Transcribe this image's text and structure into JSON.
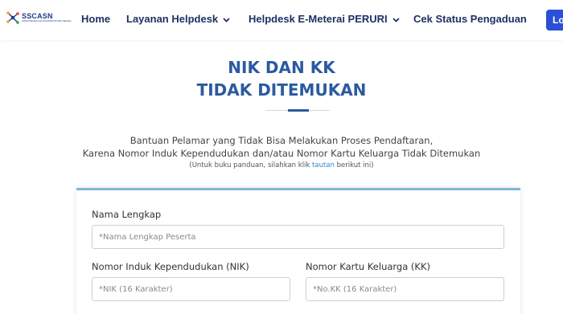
{
  "nav": {
    "logo_text": "SSCASN",
    "logo_subtext": "SISTEM SELEKSI CALON APARATUR SIPIL NEGARA",
    "home": "Home",
    "layanan_helpdesk": "Layanan Helpdesk",
    "helpdesk_emeterai": "Helpdesk E-Meterai PERURI",
    "cek_status": "Cek Status Pengaduan",
    "login": "Login"
  },
  "heading": {
    "line1": "NIK DAN KK",
    "line2": "TIDAK DITEMUKAN"
  },
  "description": {
    "line1": "Bantuan Pelamar yang Tidak Bisa Melakukan Proses Pendaftaran,",
    "line2": "Karena Nomor Induk Kependudukan dan/atau Nomor Kartu Keluarga Tidak Ditemukan",
    "note_before": "(Untuk buku panduan, silahkan klik ",
    "note_link": "tautan",
    "note_after": " berikut ini)"
  },
  "form": {
    "nama_label": "Nama Lengkap",
    "nama_placeholder": "*Nama Lengkap Peserta",
    "nik_label": "Nomor Induk Kependudukan (NIK)",
    "nik_placeholder": "*NIK (16 Karakter)",
    "kk_label": "Nomor Kartu Keluarga (KK)",
    "kk_placeholder": "*No.KK (16 Karakter)"
  },
  "colors": {
    "nav_text": "#1e3163",
    "heading": "#2b5aa0",
    "link": "#2b8ccf",
    "login_bg": "#2b4fd6",
    "card_border": "#7fb6d8"
  }
}
